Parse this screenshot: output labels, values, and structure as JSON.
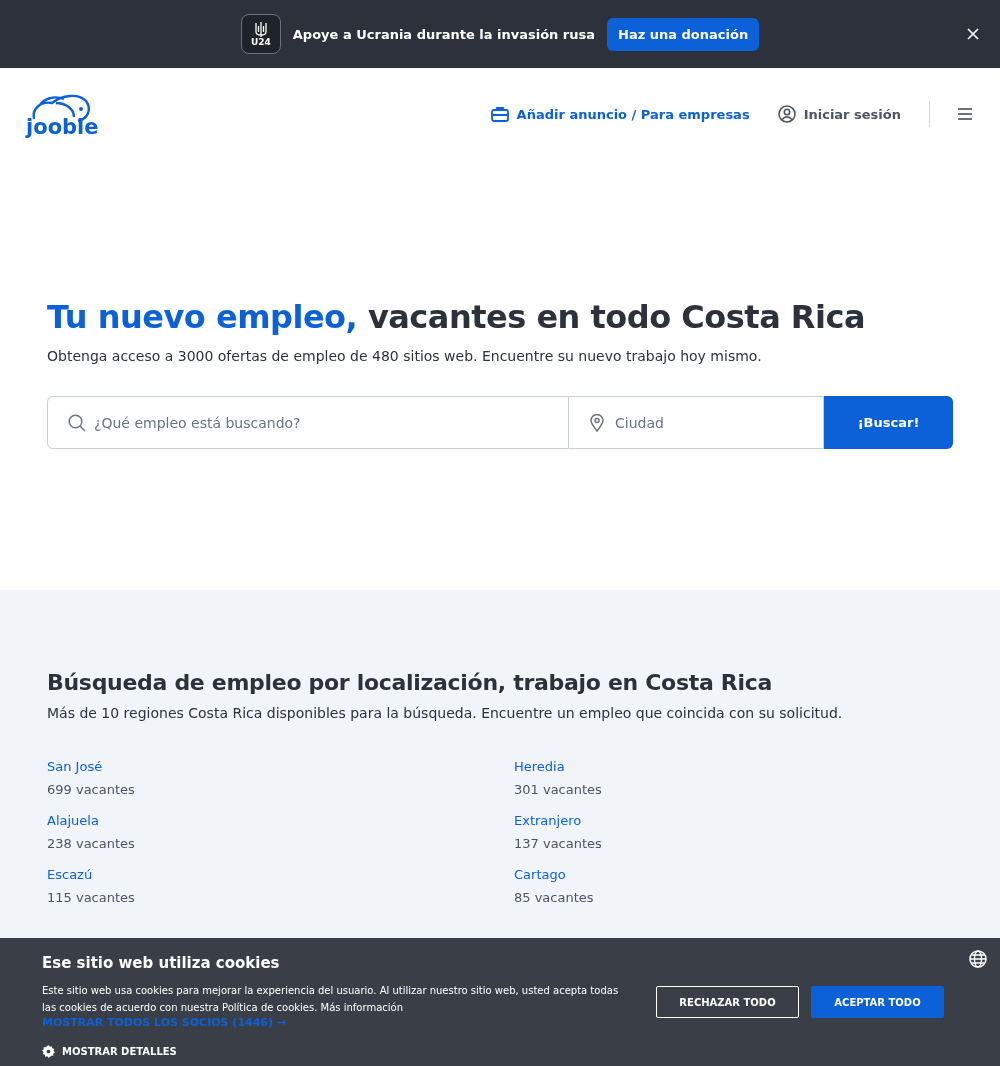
{
  "promo_bar": {
    "badge": "U24",
    "message": "Apoye a Ucrania durante la invasión rusa",
    "button": "Haz una donación"
  },
  "header": {
    "logo": "jooble",
    "post_link": "Añadir anuncio / Para empresas",
    "login_link": "Iniciar sesión"
  },
  "hero": {
    "title_highlight": "Tu nuevo empleo,",
    "title_rest": "vacantes en todo Costa Rica",
    "subtitle": "Obtenga acceso a 3000 ofertas de empleo de 480 sitios web. Encuentre su nuevo trabajo hoy mismo.",
    "search": {
      "placeholder": "¿Qué empleo está buscando?"
    },
    "city": {
      "placeholder": "Ciudad"
    },
    "button": "¡Buscar!"
  },
  "regions": {
    "title": "Búsqueda de empleo por localización, trabajo en Costa Rica",
    "subtitle": "Más de 10 regiones Costa Rica disponibles para la búsqueda. Encuentre un empleo que coincida con su solicitud.",
    "items": [
      {
        "name": "San José",
        "count": "699 vacantes"
      },
      {
        "name": "Heredia",
        "count": "301 vacantes"
      },
      {
        "name": "Alajuela",
        "count": "238 vacantes"
      },
      {
        "name": "Extranjero",
        "count": "137 vacantes"
      },
      {
        "name": "Escazú",
        "count": "115 vacantes"
      },
      {
        "name": "Cartago",
        "count": "85 vacantes"
      }
    ]
  },
  "cookie_banner": {
    "title": "Ese sitio web utiliza cookies",
    "text": "Este sitio web usa cookies para mejorar la experiencia del usuario. Al utilizar nuestro sitio web, usted acepta todas las cookies de acuerdo con nuestra Política de cookies. Más información",
    "partners_link": "MOSTRAR TODOS LOS SOCIOS (1446) →",
    "details": "MOSTRAR DETALLES",
    "reject": "RECHAZAR TODO",
    "accept": "ACEPTAR TODO"
  }
}
